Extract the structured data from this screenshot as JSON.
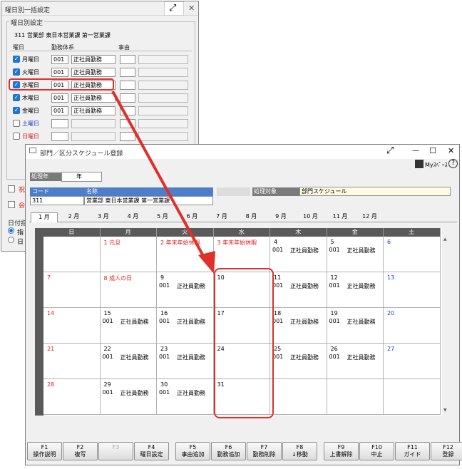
{
  "back_window": {
    "title": "曜日別一括設定",
    "section": "曜日別設定",
    "dept": "311 営業部 東日本営業課 第一営業課",
    "col_day": "曜日",
    "col_code": "勤務体系",
    "col_reason": "事由",
    "rows": [
      {
        "day": "月曜日",
        "code": "001",
        "name": "正社員勤務"
      },
      {
        "day": "火曜日",
        "code": "001",
        "name": "正社員勤務"
      },
      {
        "day": "水曜日",
        "code": "001",
        "name": "正社員勤務"
      },
      {
        "day": "木曜日",
        "code": "001",
        "name": "正社員勤務"
      },
      {
        "day": "金曜日",
        "code": "001",
        "name": "正社員勤務"
      },
      {
        "day": "土曜日",
        "code": "",
        "name": ""
      },
      {
        "day": "日曜日",
        "code": "",
        "name": ""
      }
    ],
    "opt1": "祝",
    "opt2": "会",
    "section2": "日付指",
    "r1": "指",
    "r2": "日"
  },
  "front_window": {
    "title": "部門／区分スケジュール登録",
    "myspace": "Myｽﾍﾟｰｽ",
    "help": "?",
    "year_label": "処理年",
    "year_suffix": "年",
    "code_label": "コード",
    "name_label": "名称",
    "code": "311",
    "name": "営業部 東日本営業課 第一営業課",
    "target_label": "処理対象",
    "target": "部門スケジュール",
    "months": [
      "1 月",
      "2 月",
      "3 月",
      "4 月",
      "5 月",
      "6 月",
      "7 月",
      "8 月",
      "9 月",
      "10 月",
      "11 月",
      "12 月"
    ],
    "weekdays": [
      "日",
      "月",
      "火",
      "水",
      "木",
      "金",
      "土"
    ],
    "weeks": [
      [
        {
          "d": "",
          "c": ""
        },
        {
          "d": "1 元旦",
          "c": "red"
        },
        {
          "d": "2 年末年始休暇",
          "c": "red"
        },
        {
          "d": "3 年末年始休暇",
          "c": "red"
        },
        {
          "d": "4",
          "c": "",
          "s": "001",
          "n": "正社員勤務"
        },
        {
          "d": "5",
          "c": "",
          "s": "001",
          "n": "正社員勤務"
        },
        {
          "d": "6",
          "c": "blue"
        }
      ],
      [
        {
          "d": "7",
          "c": "red"
        },
        {
          "d": "8 成人の日",
          "c": "red"
        },
        {
          "d": "9",
          "c": "",
          "s": "001",
          "n": "正社員勤務"
        },
        {
          "d": "10",
          "c": ""
        },
        {
          "d": "11",
          "c": "",
          "s": "001",
          "n": "正社員勤務"
        },
        {
          "d": "12",
          "c": "",
          "s": "001",
          "n": "正社員勤務"
        },
        {
          "d": "13",
          "c": "blue"
        }
      ],
      [
        {
          "d": "14",
          "c": "red"
        },
        {
          "d": "15",
          "c": "",
          "s": "001",
          "n": "正社員勤務"
        },
        {
          "d": "16",
          "c": "",
          "s": "001",
          "n": "正社員勤務"
        },
        {
          "d": "17",
          "c": ""
        },
        {
          "d": "18",
          "c": "",
          "s": "001",
          "n": "正社員勤務"
        },
        {
          "d": "19",
          "c": "",
          "s": "001",
          "n": "正社員勤務"
        },
        {
          "d": "20",
          "c": "blue"
        }
      ],
      [
        {
          "d": "21",
          "c": "red"
        },
        {
          "d": "22",
          "c": "",
          "s": "001",
          "n": "正社員勤務"
        },
        {
          "d": "23",
          "c": "",
          "s": "001",
          "n": "正社員勤務"
        },
        {
          "d": "24",
          "c": ""
        },
        {
          "d": "25",
          "c": "",
          "s": "001",
          "n": "正社員勤務"
        },
        {
          "d": "26",
          "c": "",
          "s": "001",
          "n": "正社員勤務"
        },
        {
          "d": "27",
          "c": "blue"
        }
      ],
      [
        {
          "d": "28",
          "c": "red"
        },
        {
          "d": "29",
          "c": "",
          "s": "001",
          "n": "正社員勤務"
        },
        {
          "d": "30",
          "c": "",
          "s": "001",
          "n": "正社員勤務"
        },
        {
          "d": "31",
          "c": ""
        },
        {
          "d": "",
          "c": ""
        },
        {
          "d": "",
          "c": ""
        },
        {
          "d": "",
          "c": ""
        }
      ]
    ],
    "fkeys": [
      {
        "k": "F1",
        "l": "操作説明"
      },
      {
        "k": "F2",
        "l": "複写"
      },
      {
        "k": "F3",
        "l": "",
        "dis": true
      },
      {
        "k": "F4",
        "l": "曜日設定"
      },
      {
        "k": "F5",
        "l": "事由追加"
      },
      {
        "k": "F6",
        "l": "勤務追加"
      },
      {
        "k": "F7",
        "l": "勤務削除"
      },
      {
        "k": "F8",
        "l": "↓移動"
      },
      {
        "k": "F9",
        "l": "上書解除"
      },
      {
        "k": "F10",
        "l": "中止"
      },
      {
        "k": "F11",
        "l": "ガイド"
      },
      {
        "k": "F12",
        "l": "登録"
      }
    ]
  },
  "colors": {
    "annotation": "#e0302a",
    "header": "#4c7ec9"
  }
}
